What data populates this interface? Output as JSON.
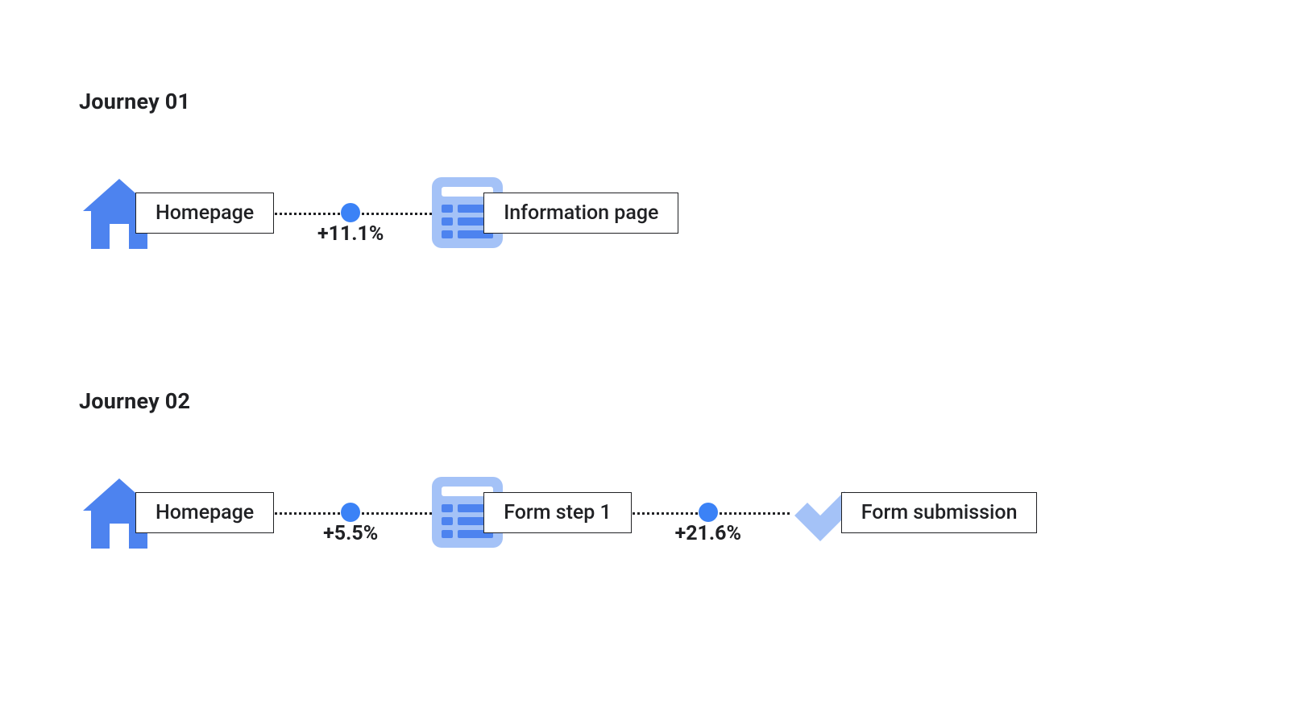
{
  "colors": {
    "icon_primary": "#4d83ef",
    "icon_light": "#a4c2f7",
    "dot": "#3b82f6",
    "text": "#202124"
  },
  "journeys": [
    {
      "title": "Journey 01",
      "steps": [
        {
          "icon": "home",
          "label": "Homepage"
        },
        {
          "icon": "page",
          "label": "Information page"
        }
      ],
      "connectors": [
        {
          "delta": "+11.1%"
        }
      ]
    },
    {
      "title": "Journey 02",
      "steps": [
        {
          "icon": "home",
          "label": "Homepage"
        },
        {
          "icon": "page",
          "label": "Form step 1"
        },
        {
          "icon": "check",
          "label": "Form submission"
        }
      ],
      "connectors": [
        {
          "delta": "+5.5%"
        },
        {
          "delta": "+21.6%"
        }
      ]
    }
  ]
}
